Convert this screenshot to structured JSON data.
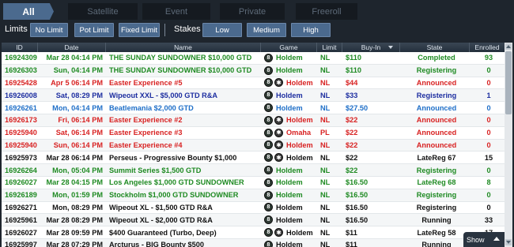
{
  "tabs": [
    {
      "label": "All"
    },
    {
      "label": "Satellite"
    },
    {
      "label": "Event"
    },
    {
      "label": "Private"
    },
    {
      "label": "Freeroll"
    }
  ],
  "filters": {
    "limits_label": "Limits",
    "limits": [
      "No Limit",
      "Pot Limit",
      "Fixed Limit"
    ],
    "stakes_label": "Stakes",
    "stakes": [
      "Low",
      "Medium",
      "High"
    ]
  },
  "columns": [
    "ID",
    "Date",
    "Name",
    "Game",
    "Limit",
    "Buy-In",
    "State",
    "Enrolled"
  ],
  "rows": [
    {
      "id": "16924309",
      "date": "Mar 28 04:14 PM",
      "name": "THE SUNDAY SUNDOWNER $10,000 GTD",
      "game": "Holdem",
      "icon": "8",
      "limit": "NL",
      "buyin": "$110",
      "state": "Completed",
      "enrolled": "93",
      "color": "green"
    },
    {
      "id": "16926303",
      "date": "Sun, 04:14 PM",
      "name": "THE SUNDAY SUNDOWNER $10,000 GTD",
      "game": "Holdem",
      "icon": "8",
      "limit": "NL",
      "buyin": "$110",
      "state": "Registering",
      "enrolled": "0",
      "color": "green"
    },
    {
      "id": "16925428",
      "date": "Apr 5 06:14 PM",
      "name": "Easter Experience #5",
      "game": "Holdem",
      "icon": "8",
      "icon2": "x",
      "limit": "NL",
      "buyin": "$44",
      "state": "Announced",
      "enrolled": "0",
      "color": "red"
    },
    {
      "id": "16926008",
      "date": "Sat, 08:29 PM",
      "name": "Wipeout XXL - $5,000 GTD R&A",
      "game": "Holdem",
      "icon": "8",
      "limit": "NL",
      "buyin": "$33",
      "state": "Registering",
      "enrolled": "1",
      "color": "navy"
    },
    {
      "id": "16926261",
      "date": "Mon, 04:14 PM",
      "name": "Beatlemania $2,000 GTD",
      "game": "Holdem",
      "icon": "8",
      "limit": "NL",
      "buyin": "$27.50",
      "state": "Announced",
      "enrolled": "0",
      "color": "blue"
    },
    {
      "id": "16926173",
      "date": "Fri, 06:14 PM",
      "name": "Easter Experience #2",
      "game": "Holdem",
      "icon": "8",
      "icon2": "x",
      "limit": "NL",
      "buyin": "$22",
      "state": "Announced",
      "enrolled": "0",
      "color": "red"
    },
    {
      "id": "16925940",
      "date": "Sat, 06:14 PM",
      "name": "Easter Experience #3",
      "game": "Omaha",
      "icon": "8",
      "icon2": "x",
      "limit": "PL",
      "buyin": "$22",
      "state": "Announced",
      "enrolled": "0",
      "color": "red"
    },
    {
      "id": "16925940",
      "date": "Sun, 06:14 PM",
      "name": "Easter Experience #4",
      "game": "Holdem",
      "icon": "8",
      "icon2": "x",
      "limit": "NL",
      "buyin": "$22",
      "state": "Announced",
      "enrolled": "0",
      "color": "red"
    },
    {
      "id": "16925973",
      "date": "Mar 28 06:14 PM",
      "name": "Perseus - Progressive Bounty $1,000",
      "game": "Holdem",
      "icon": "8",
      "icon2": "x",
      "limit": "NL",
      "buyin": "$22",
      "state": "LateReg 67",
      "enrolled": "15",
      "color": "black"
    },
    {
      "id": "16926264",
      "date": "Mon, 05:04 PM",
      "name": "Summit Series $1,500 GTD",
      "game": "Holdem",
      "icon": "8",
      "limit": "NL",
      "buyin": "$22",
      "state": "Registering",
      "enrolled": "0",
      "color": "green"
    },
    {
      "id": "16926027",
      "date": "Mar 28 04:15 PM",
      "name": "Los Angeles $1,000 GTD SUNDOWNER",
      "game": "Holdem",
      "icon": "8",
      "limit": "NL",
      "buyin": "$16.50",
      "state": "LateReg 68",
      "enrolled": "8",
      "color": "green"
    },
    {
      "id": "16926189",
      "date": "Mon, 01:59 PM",
      "name": "Stockholm $1,000 GTD SUNDOWNER",
      "game": "Holdem",
      "icon": "8",
      "limit": "NL",
      "buyin": "$16.50",
      "state": "Registering",
      "enrolled": "0",
      "color": "green"
    },
    {
      "id": "16926271",
      "date": "Mon, 08:29 PM",
      "name": "Wipeout XL - $1,500 GTD R&A",
      "game": "Holdem",
      "icon": "8",
      "limit": "NL",
      "buyin": "$16.50",
      "state": "Registering",
      "enrolled": "0",
      "color": "black"
    },
    {
      "id": "16925961",
      "date": "Mar 28 08:29 PM",
      "name": "Wipeout XL - $2,000 GTD R&A",
      "game": "Holdem",
      "icon": "8",
      "limit": "NL",
      "buyin": "$16.50",
      "state": "Running",
      "enrolled": "33",
      "color": "black"
    },
    {
      "id": "16926027",
      "date": "Mar 28 09:59 PM",
      "name": "$400 Guaranteed (Turbo, Deep)",
      "game": "Holdem",
      "icon": "8",
      "icon2": "x",
      "limit": "NL",
      "buyin": "$11",
      "state": "LateReg 58",
      "enrolled": "17",
      "color": "black"
    },
    {
      "id": "16925997",
      "date": "Mar 28 07:29 PM",
      "name": "Arcturus - BIG Bounty $500",
      "game": "Holdem",
      "icon": "8",
      "limit": "NL",
      "buyin": "$11",
      "state": "Running",
      "enrolled": "",
      "color": "black"
    }
  ],
  "show_toggle": {
    "label": "Show"
  },
  "colors": {
    "accent": "#4b6a8e",
    "green": "#1e8a22",
    "red": "#d82222",
    "blue": "#1f6fc8",
    "navy": "#1d2ea0"
  }
}
